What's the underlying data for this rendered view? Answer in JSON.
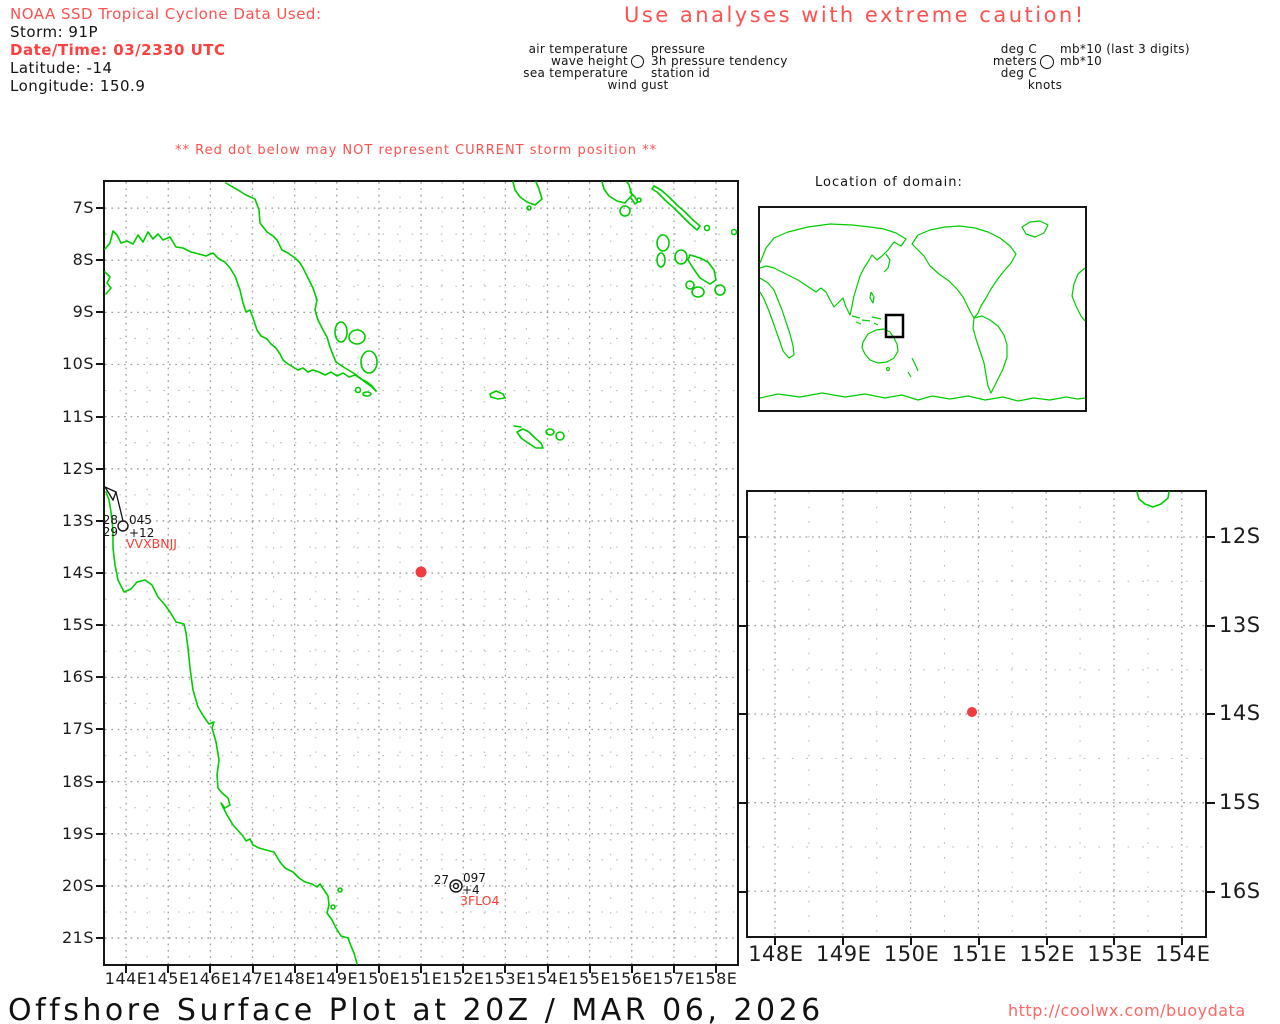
{
  "header": {
    "noaa_line": "NOAA SSD Tropical Cyclone Data Used:",
    "storm": "Storm: 91P",
    "datetime": "Date/Time: 03/2330 UTC",
    "latitude": "Latitude: -14",
    "longitude": "Longitude: 150.9",
    "caution": "Use analyses with extreme caution!"
  },
  "legend": {
    "center": {
      "left": [
        "air temperature",
        "wave height",
        "sea temperature"
      ],
      "right": [
        "pressure",
        "3h pressure tendency",
        "station id"
      ],
      "bottom": "wind gust"
    },
    "units": {
      "left": [
        "deg C",
        "meters",
        "deg C"
      ],
      "right": [
        "mb*10 (last 3 digits)",
        "mb*10"
      ],
      "bottom": "knots"
    }
  },
  "warning": "** Red dot below may NOT represent CURRENT storm position **",
  "main_map": {
    "lat_labels": [
      "7S",
      "8S",
      "9S",
      "10S",
      "11S",
      "12S",
      "13S",
      "14S",
      "15S",
      "16S",
      "17S",
      "18S",
      "19S",
      "20S",
      "21S"
    ],
    "lon_labels": [
      "144E",
      "145E",
      "146E",
      "147E",
      "148E",
      "149E",
      "150E",
      "151E",
      "152E",
      "153E",
      "154E",
      "155E",
      "156E",
      "157E",
      "158E"
    ],
    "stations": [
      {
        "air_temp": "28",
        "sea_temp": "29",
        "pressure": "045",
        "tendency": "+12",
        "id": "VVXBNJJ"
      },
      {
        "air_temp": "27",
        "pressure": "097",
        "tendency": "+4",
        "id": "3FLO4"
      }
    ]
  },
  "inset": {
    "title": "Location of domain:"
  },
  "zoom_map": {
    "lat_labels": [
      "12S",
      "13S",
      "14S",
      "15S",
      "16S"
    ],
    "lon_labels": [
      "148E",
      "149E",
      "150E",
      "151E",
      "152E",
      "153E",
      "154E"
    ]
  },
  "footer": {
    "title": "Offshore Surface Plot at 20Z / MAR 06, 2026",
    "url": "http://coolwx.com/buoydata"
  },
  "colors": {
    "coastline_green": "#00cc00",
    "warning_red": "#ff5050",
    "station_id_red": "#ff3b30",
    "storm_dot_red": "#f03c3c"
  }
}
